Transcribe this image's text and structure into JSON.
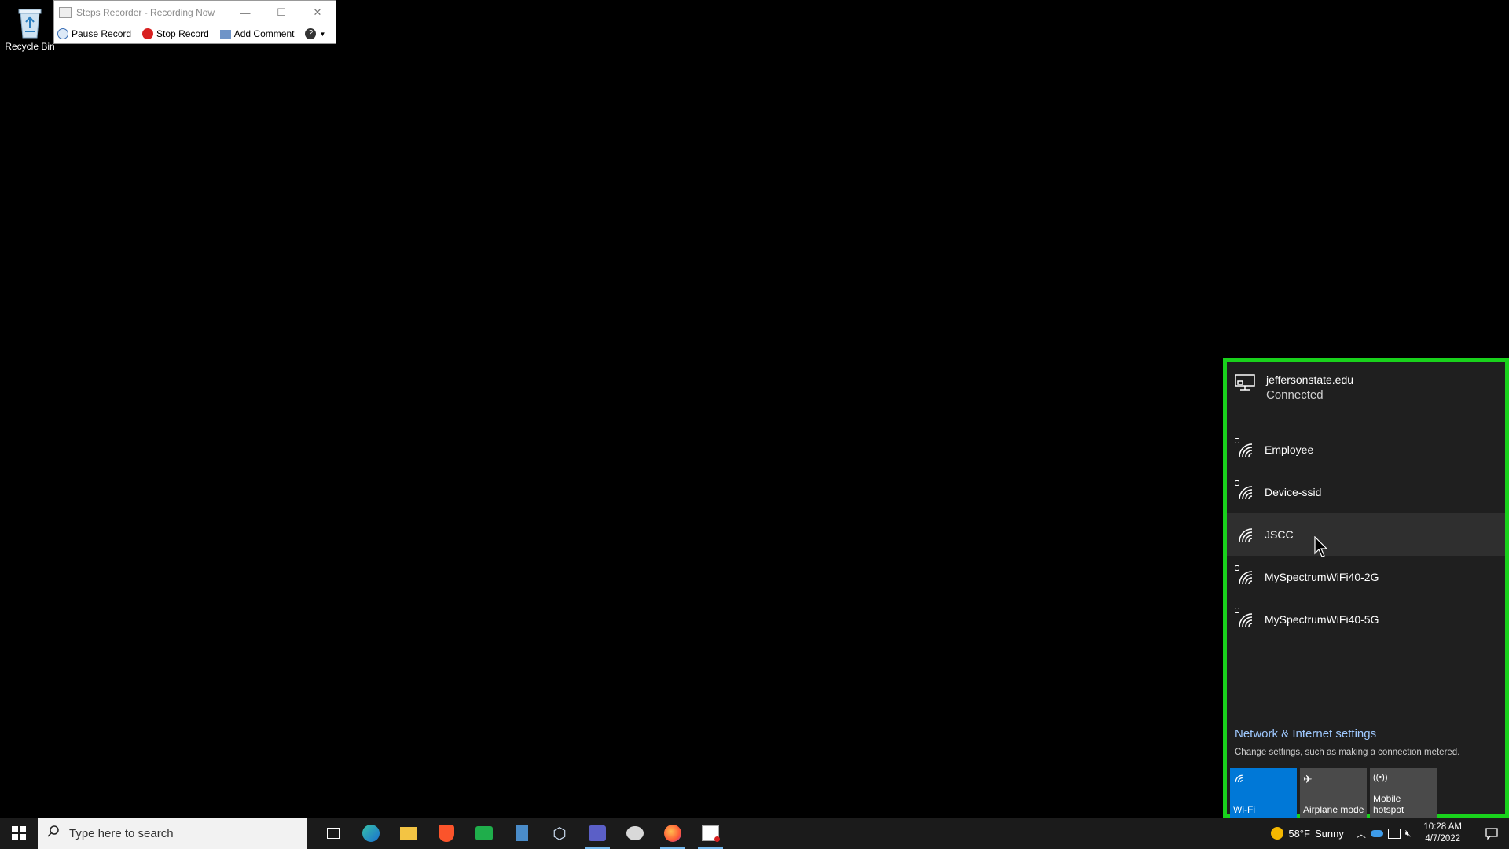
{
  "desktop": {
    "recycle_bin_label": "Recycle Bin"
  },
  "steps_recorder": {
    "title": "Steps Recorder - Recording Now",
    "pause_label": "Pause Record",
    "stop_label": "Stop Record",
    "comment_label": "Add Comment"
  },
  "network_flyout": {
    "connected": {
      "name": "jeffersonstate.edu",
      "status": "Connected"
    },
    "networks": [
      {
        "name": "Employee",
        "secured": true
      },
      {
        "name": "Device-ssid",
        "secured": true
      },
      {
        "name": "JSCC",
        "secured": false
      },
      {
        "name": "MySpectrumWiFi40-2G",
        "secured": true
      },
      {
        "name": "MySpectrumWiFi40-5G",
        "secured": true
      }
    ],
    "settings_link": "Network & Internet settings",
    "settings_sub": "Change settings, such as making a connection metered.",
    "tiles": [
      {
        "label": "Wi-Fi",
        "active": true,
        "icon": "wifi-icon"
      },
      {
        "label": "Airplane mode",
        "active": false,
        "icon": "airplane-icon"
      },
      {
        "label": "Mobile hotspot",
        "active": false,
        "icon": "hotspot-icon"
      }
    ],
    "border_color": "#19d21c"
  },
  "taskbar": {
    "search_placeholder": "Type here to search",
    "weather": {
      "temp": "58°F",
      "condition": "Sunny"
    },
    "clock": {
      "time": "10:28 AM",
      "date": "4/7/2022"
    }
  },
  "colors": {
    "accent": "#0078d7",
    "link": "#9fc9ff"
  }
}
